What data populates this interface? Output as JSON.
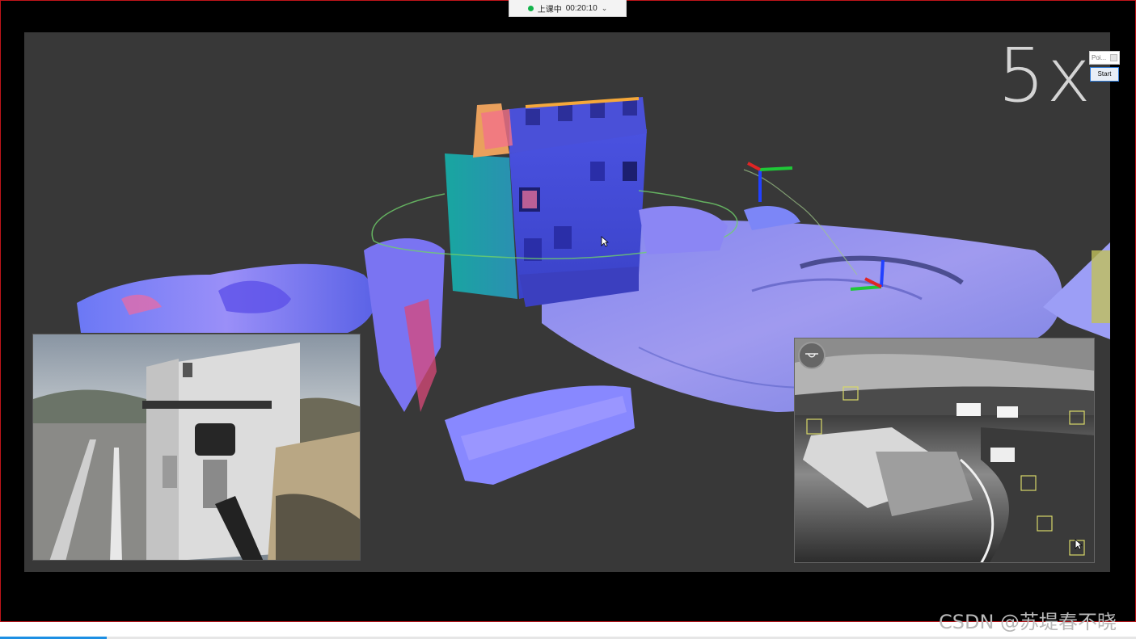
{
  "recording": {
    "status_label": "上课中",
    "elapsed": "00:20:10"
  },
  "video": {
    "speed_label": "5x"
  },
  "overlay_panel": {
    "field_text": "Poi...",
    "start_label": "Start"
  },
  "watermark": "CSDN @苏堤春不晓",
  "progress": {
    "fraction": 0.094
  },
  "colors": {
    "frame_border": "#c0141a",
    "recording_dot": "#13b34b",
    "progress_fill": "#1d8fe3"
  },
  "icons": {
    "recording": "recording-dot-icon",
    "dropdown": "chevron-down-icon",
    "camera": "camera-toggle-icon",
    "cursor": "mouse-cursor-icon"
  }
}
